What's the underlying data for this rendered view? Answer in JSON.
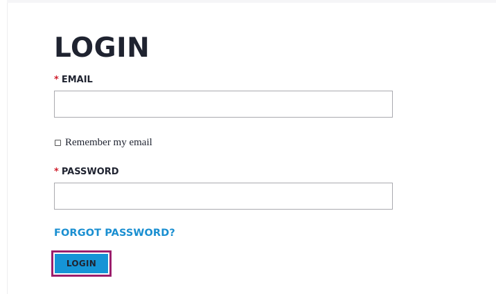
{
  "form": {
    "title": "LOGIN",
    "required_marker": "*",
    "email": {
      "label": "EMAIL",
      "value": "",
      "placeholder": ""
    },
    "remember": {
      "label": "Remember my email",
      "checked": false
    },
    "password": {
      "label": "PASSWORD",
      "value": "",
      "placeholder": ""
    },
    "forgot_link": "FORGOT PASSWORD?",
    "submit_label": "LOGIN"
  },
  "colors": {
    "heading": "#1f2330",
    "required": "#d0202e",
    "link": "#1a8fd1",
    "button_bg": "#1594d6",
    "focus_outline": "#9b1e6c"
  }
}
